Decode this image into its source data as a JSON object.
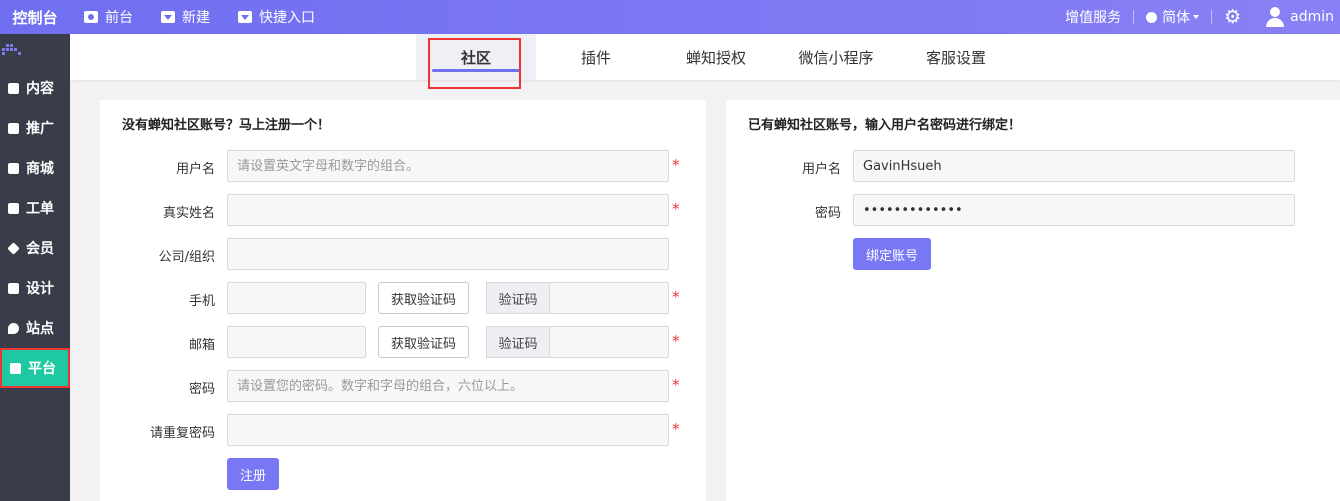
{
  "app": {
    "logo": "控制台"
  },
  "topnav": [
    {
      "label": "前台",
      "icon": "eye-icon"
    },
    {
      "label": "新建",
      "icon": "caret-down-icon"
    },
    {
      "label": "快捷入口",
      "icon": "caret-down-icon"
    }
  ],
  "topright": {
    "service": "增值服务",
    "language": "简体",
    "user": "admin"
  },
  "sidebar": {
    "items": [
      {
        "label": "内容",
        "icon": "document-icon"
      },
      {
        "label": "推广",
        "icon": "megaphone-icon"
      },
      {
        "label": "商城",
        "icon": "shop-icon"
      },
      {
        "label": "工单",
        "icon": "ticket-icon"
      },
      {
        "label": "会员",
        "icon": "diamond-icon"
      },
      {
        "label": "设计",
        "icon": "design-icon"
      },
      {
        "label": "站点",
        "icon": "location-icon"
      },
      {
        "label": "平台",
        "icon": "platform-icon",
        "active": true
      }
    ]
  },
  "tabs": [
    {
      "label": "社区",
      "active": true
    },
    {
      "label": "插件"
    },
    {
      "label": "蝉知授权"
    },
    {
      "label": "微信小程序"
    },
    {
      "label": "客服设置"
    }
  ],
  "register": {
    "title": "没有蝉知社区账号？马上注册一个！",
    "username_label": "用户名",
    "username_placeholder": "请设置英文字母和数字的组合。",
    "realname_label": "真实姓名",
    "company_label": "公司/组织",
    "phone_label": "手机",
    "email_label": "邮箱",
    "get_code_label": "获取验证码",
    "code_label": "验证码",
    "password_label": "密码",
    "password_placeholder": "请设置您的密码。数字和字母的组合，六位以上。",
    "repeat_password_label": "请重复密码",
    "required_mark": "*",
    "submit_label": "注册"
  },
  "bind": {
    "title": "已有蝉知社区账号，输入用户名密码进行绑定！",
    "username_label": "用户名",
    "username_value": "GavinHsueh",
    "password_label": "密码",
    "password_value": "•••••••••••••",
    "submit_label": "绑定账号"
  }
}
